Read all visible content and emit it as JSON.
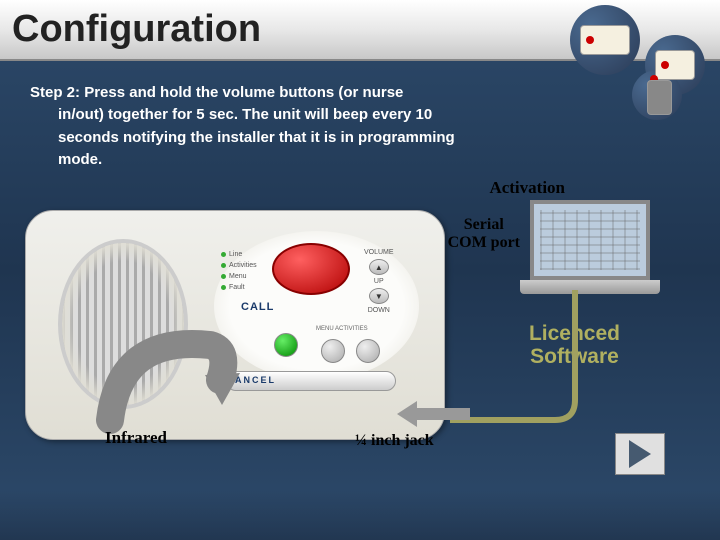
{
  "title": "Configuration",
  "step": {
    "label": "Step 2:",
    "body_line1": "Press and hold the volume buttons (or nurse",
    "body_line2": "in/out) together for 5 sec.  The unit will beep every 10",
    "body_line3": "seconds notifying the installer that it is in programming",
    "body_line4": "mode."
  },
  "device": {
    "leds": {
      "line": "Line",
      "activities": "Activities",
      "menu": "Menu",
      "fault": "Fault"
    },
    "call_label": "CALL",
    "volume_title": "VOLUME",
    "volume_up": "UP",
    "volume_down": "DOWN",
    "menu_act": "MENU   ACTIVITIES",
    "cancel": "ANCEL"
  },
  "annotations": {
    "activation": "Activation",
    "serial_line1": "Serial",
    "serial_line2": "COM port",
    "licenced_line1": "Licenced",
    "licenced_line2": "Software",
    "jack": "¼ inch jack",
    "infrared": "Infrared"
  },
  "controls": {
    "play": "Play"
  }
}
